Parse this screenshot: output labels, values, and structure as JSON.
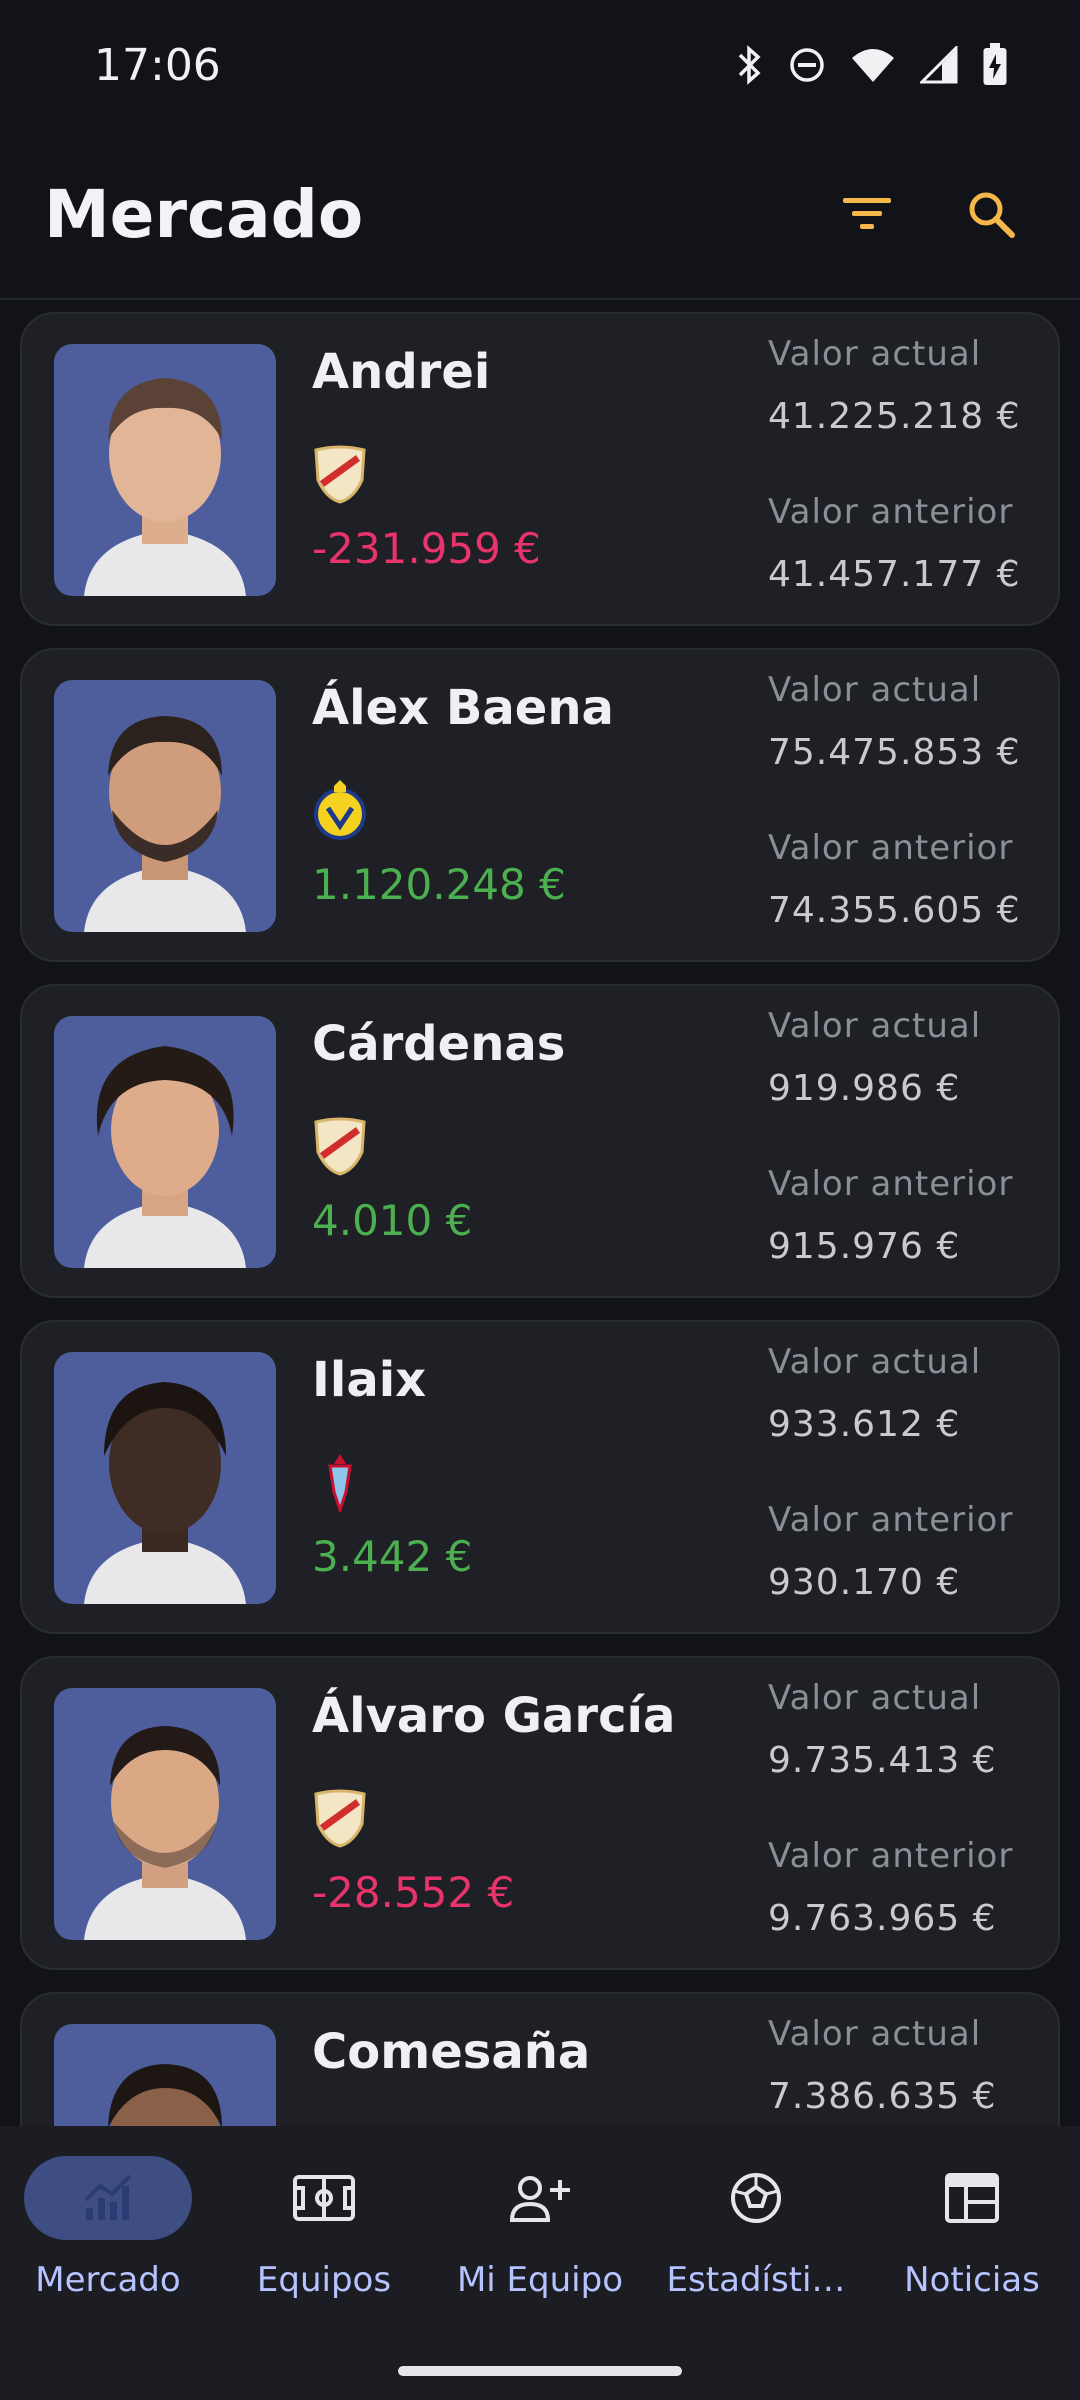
{
  "status_bar": {
    "time": "17:06"
  },
  "header": {
    "title": "Mercado"
  },
  "players": [
    {
      "name": "Andrei",
      "club": "rayo-vallecano",
      "change": "-231.959 €",
      "trend": "negative",
      "current_label": "Valor actual",
      "current_value": "41.225.218 €",
      "previous_label": "Valor anterior",
      "previous_value": "41.457.177 €"
    },
    {
      "name": "Álex Baena",
      "club": "villarreal",
      "change": "1.120.248 €",
      "trend": "positive",
      "current_label": "Valor actual",
      "current_value": "75.475.853 €",
      "previous_label": "Valor anterior",
      "previous_value": "74.355.605 €"
    },
    {
      "name": "Cárdenas",
      "club": "rayo-vallecano",
      "change": "4.010 €",
      "trend": "positive",
      "current_label": "Valor actual",
      "current_value": "919.986 €",
      "previous_label": "Valor anterior",
      "previous_value": "915.976 €"
    },
    {
      "name": "Ilaix",
      "club": "celta",
      "change": "3.442 €",
      "trend": "positive",
      "current_label": "Valor actual",
      "current_value": "933.612 €",
      "previous_label": "Valor anterior",
      "previous_value": "930.170 €"
    },
    {
      "name": "Álvaro García",
      "club": "rayo-vallecano",
      "change": "-28.552 €",
      "trend": "negative",
      "current_label": "Valor actual",
      "current_value": "9.735.413 €",
      "previous_label": "Valor anterior",
      "previous_value": "9.763.965 €"
    },
    {
      "name": "Comesaña",
      "club": "",
      "change": "",
      "trend": "",
      "current_label": "Valor actual",
      "current_value": "7.386.635 €",
      "previous_label": "",
      "previous_value": ""
    }
  ],
  "nav": [
    {
      "label": "Mercado",
      "icon": "chart-icon",
      "active": true
    },
    {
      "label": "Equipos",
      "icon": "field-icon",
      "active": false
    },
    {
      "label": "Mi Equipo",
      "icon": "add-person-icon",
      "active": false
    },
    {
      "label": "Estadísti…",
      "icon": "soccer-ball-icon",
      "active": false
    },
    {
      "label": "Noticias",
      "icon": "newspaper-icon",
      "active": false
    }
  ],
  "colors": {
    "accent": "#3e4d82",
    "positive": "#4caf50",
    "negative": "#e8336b",
    "filter_icon": "#f5b74a",
    "photo_bg": "#4e5e9c"
  }
}
